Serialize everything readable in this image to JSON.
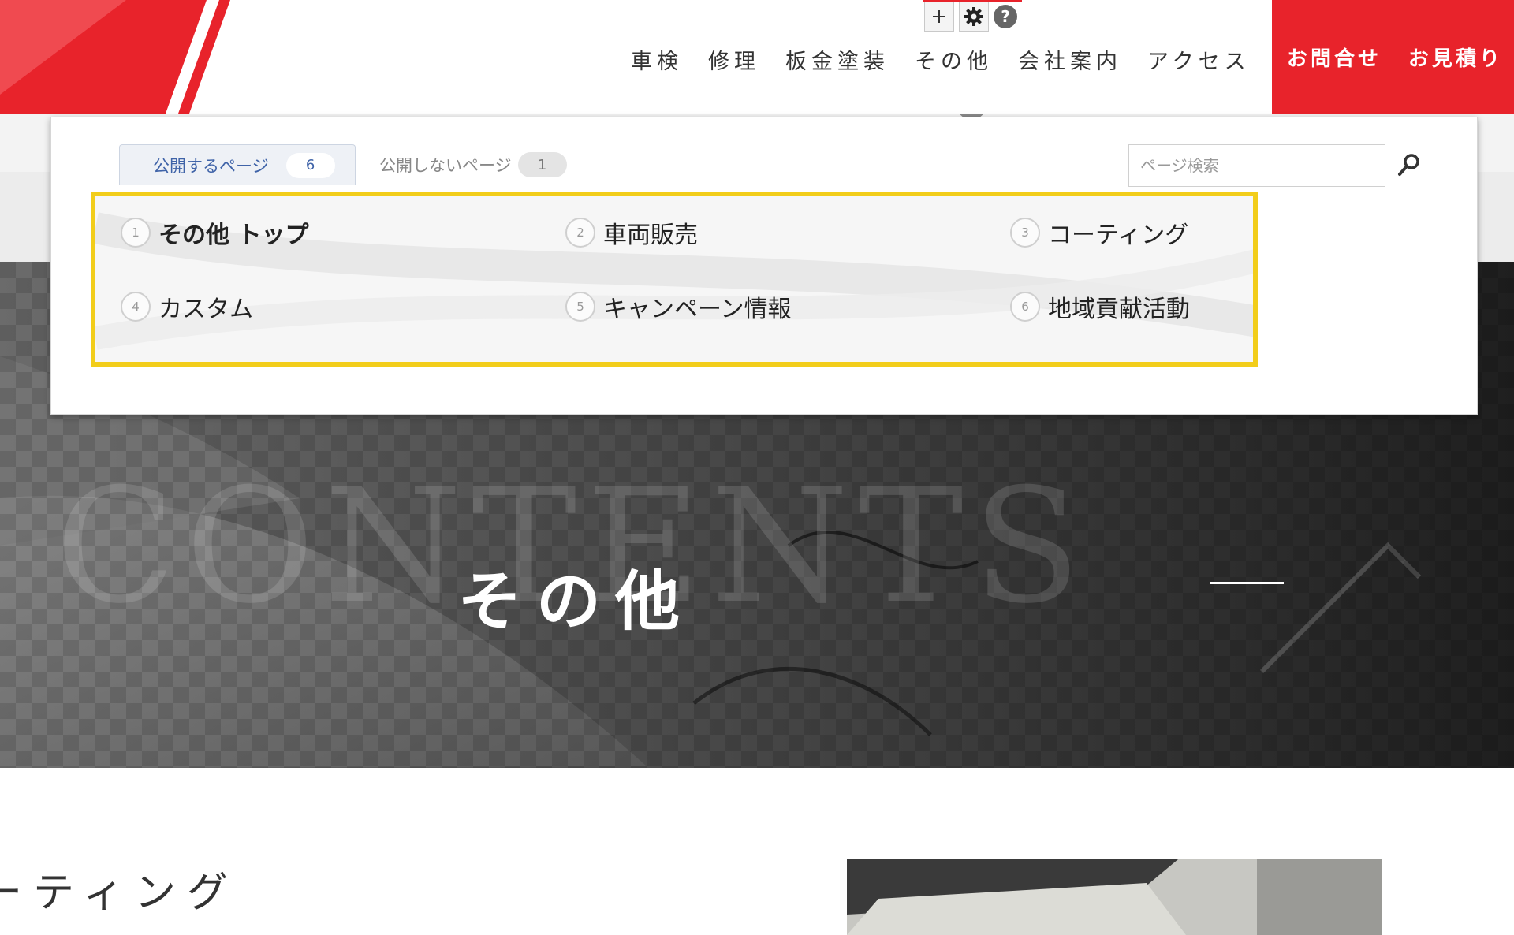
{
  "nav": {
    "items": [
      "車検",
      "修理",
      "板金塗装",
      "その他",
      "会社案内",
      "アクセス"
    ],
    "contact_label": "お問合せ",
    "estimate_label": "お見積り"
  },
  "editor_toolbar": {
    "add_icon": "plus-icon",
    "settings_icon": "gear-icon",
    "help_icon": "help-icon",
    "help_label": "?"
  },
  "panel": {
    "tabs": [
      {
        "label": "公開するページ",
        "count": "6"
      },
      {
        "label": "公開しないページ",
        "count": "1"
      }
    ],
    "search": {
      "placeholder": "ページ検索"
    },
    "pages": [
      {
        "number": "1",
        "label": "その他 トップ"
      },
      {
        "number": "2",
        "label": "車両販売"
      },
      {
        "number": "3",
        "label": "コーティング"
      },
      {
        "number": "4",
        "label": "カスタム"
      },
      {
        "number": "5",
        "label": "キャンペーン情報"
      },
      {
        "number": "6",
        "label": "地域貢献活動"
      }
    ]
  },
  "hero": {
    "watermark": "CONTENTS",
    "title": "その他"
  },
  "section": {
    "heading": "ーティング"
  },
  "colors": {
    "brand_red": "#e8232b",
    "highlight_yellow": "#f2cd1a",
    "tab_blue": "#3f63a8"
  }
}
